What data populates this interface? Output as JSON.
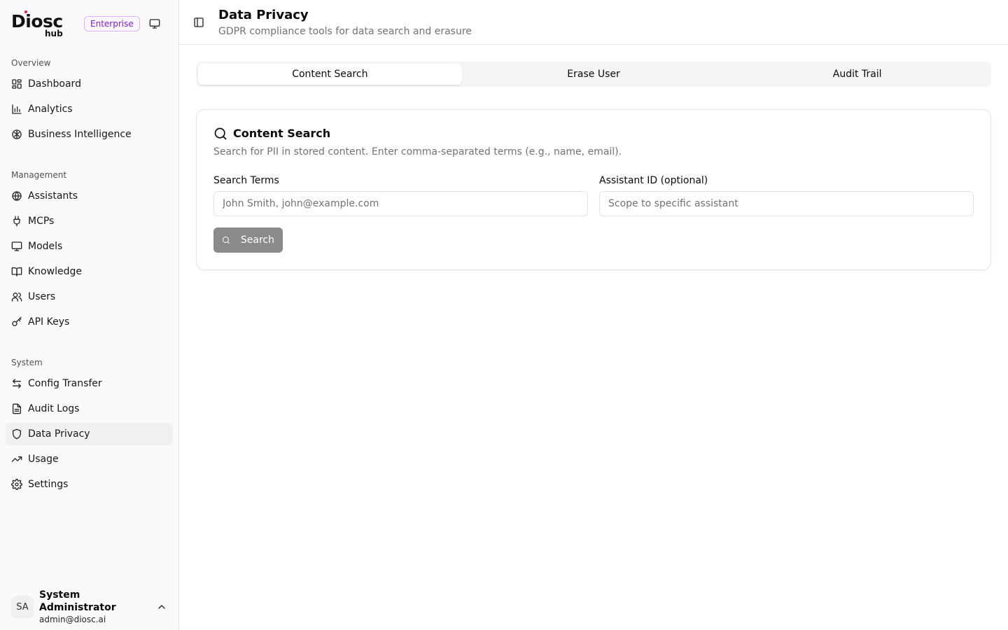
{
  "brand": {
    "logo_main": "Diosc",
    "logo_sub": "hub",
    "badge": "Enterprise"
  },
  "sidebar": {
    "sections": [
      {
        "label": "Overview",
        "items": [
          {
            "label": "Dashboard",
            "icon": "dashboard-icon"
          },
          {
            "label": "Analytics",
            "icon": "bar-chart-icon"
          },
          {
            "label": "Business Intelligence",
            "icon": "brain-icon"
          }
        ]
      },
      {
        "label": "Management",
        "items": [
          {
            "label": "Assistants",
            "icon": "globe-icon"
          },
          {
            "label": "MCPs",
            "icon": "plug-icon"
          },
          {
            "label": "Models",
            "icon": "monitor-icon"
          },
          {
            "label": "Knowledge",
            "icon": "book-icon"
          },
          {
            "label": "Users",
            "icon": "users-icon"
          },
          {
            "label": "API Keys",
            "icon": "key-icon"
          }
        ]
      },
      {
        "label": "System",
        "items": [
          {
            "label": "Config Transfer",
            "icon": "arrows-icon"
          },
          {
            "label": "Audit Logs",
            "icon": "file-icon"
          },
          {
            "label": "Data Privacy",
            "icon": "shield-icon",
            "active": true
          },
          {
            "label": "Usage",
            "icon": "trend-icon"
          },
          {
            "label": "Settings",
            "icon": "gear-icon"
          }
        ]
      }
    ]
  },
  "user": {
    "initials": "SA",
    "name": "System Administrator",
    "email": "admin@diosc.ai"
  },
  "header": {
    "title": "Data Privacy",
    "subtitle": "GDPR compliance tools for data search and erasure"
  },
  "tabs": [
    {
      "label": "Content Search",
      "active": true
    },
    {
      "label": "Erase User"
    },
    {
      "label": "Audit Trail"
    }
  ],
  "card": {
    "title": "Content Search",
    "description": "Search for PII in stored content. Enter comma-separated terms (e.g., name, email).",
    "search_terms_label": "Search Terms",
    "search_terms_placeholder": "John Smith, john@example.com",
    "search_terms_value": "",
    "assistant_label": "Assistant ID (optional)",
    "assistant_placeholder": "Scope to specific assistant",
    "assistant_value": "",
    "button_label": "Search"
  },
  "colors": {
    "badge_text": "#7e22ce",
    "badge_border": "#d8b4fe",
    "button_bg": "#8a8a8a",
    "active_nav_bg": "#f0f0f0"
  }
}
